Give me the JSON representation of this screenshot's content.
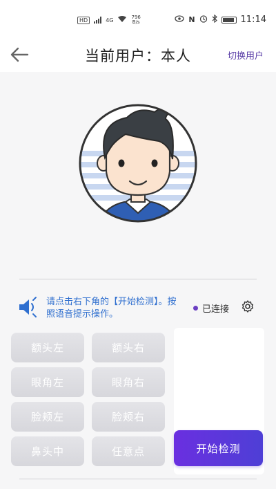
{
  "status_bar": {
    "hd": "HD",
    "network": "4G",
    "speed_value": "796",
    "speed_unit": "B/s",
    "nfc": "N",
    "time": "11:14"
  },
  "header": {
    "title": "当前用户：本人",
    "switch_user_label": "切换用户"
  },
  "hint": {
    "text": "请点击右下角的【开始检测】。按照语音提示操作。"
  },
  "connection": {
    "status_label": "已连接",
    "status_color": "#6b3fc2"
  },
  "positions": {
    "forehead_left": "额头左",
    "forehead_right": "额头右",
    "eye_corner_left": "眼角左",
    "eye_corner_right": "眼角右",
    "cheek_left": "脸颊左",
    "cheek_right": "脸颊右",
    "nose_middle": "鼻头中",
    "any_point": "任意点"
  },
  "actions": {
    "start_label": "开始检测"
  },
  "colors": {
    "accent": "#6a2fe0",
    "hint_text": "#2f6fcf",
    "button_disabled": "#dcdce0"
  }
}
